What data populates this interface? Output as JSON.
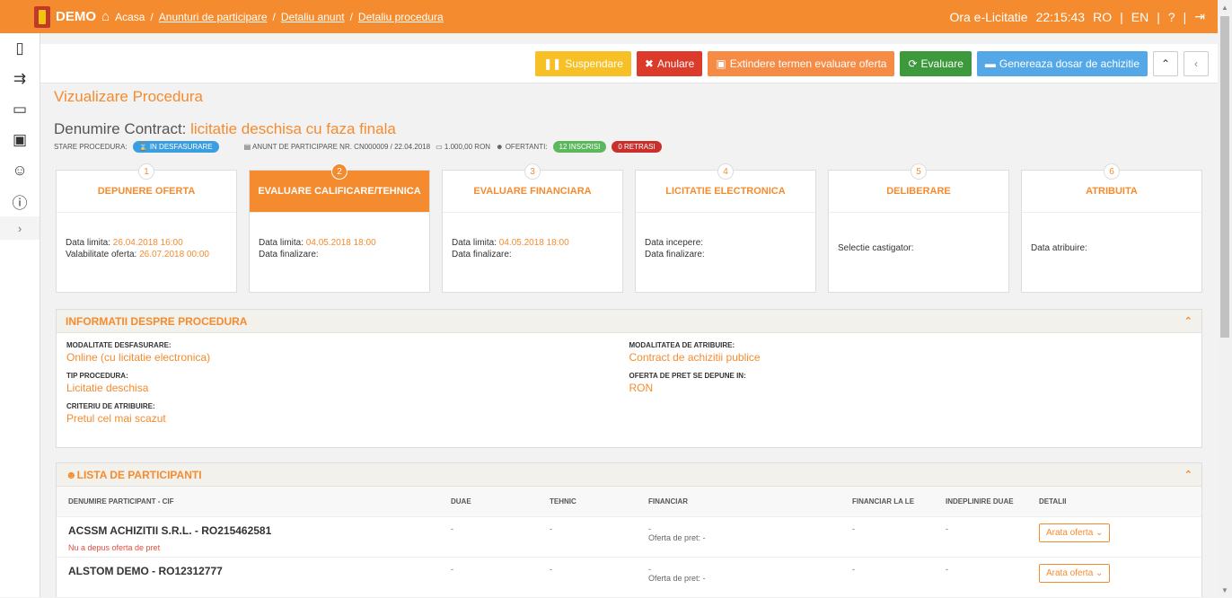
{
  "topbar": {
    "brand": "DEMO",
    "home": "Acasa",
    "breadcrumbs": [
      "Anunturi de participare",
      "Detaliu anunt",
      "Detaliu procedura"
    ],
    "clock_label": "Ora e-Licitatie",
    "clock": "22:15:43",
    "lang_ro": "RO",
    "lang_en": "EN"
  },
  "actions": {
    "suspend": "Suspendare",
    "cancel": "Anulare",
    "extend": "Extindere termen evaluare oferta",
    "evaluate": "Evaluare",
    "generate": "Genereaza dosar de achizitie"
  },
  "page": {
    "title": "Vizualizare Procedura",
    "contract_label": "Denumire Contract:",
    "contract_name": "licitatie deschisa cu faza finala",
    "status_label": "STARE PROCEDURA:",
    "status": "IN DESFASURARE",
    "announce": "ANUNT DE PARTICIPARE NR. CN000009 / 22.04.2018",
    "amount": "1.000,00 RON",
    "bidders_label": "OFERTANTI:",
    "registered": "12 INSCRISI",
    "withdrawn": "0 RETRASI"
  },
  "steps": [
    {
      "num": "1",
      "title": "DEPUNERE OFERTA",
      "l1": "Data limita:",
      "v1": "26.04.2018 16:00",
      "l2": "Valabilitate oferta:",
      "v2": "26.07.2018 00:00"
    },
    {
      "num": "2",
      "title": "EVALUARE CALIFICARE/TEHNICA",
      "l1": "Data limita:",
      "v1": "04.05.2018 18:00",
      "l2": "Data finalizare:",
      "v2": ""
    },
    {
      "num": "3",
      "title": "EVALUARE FINANCIARA",
      "l1": "Data limita:",
      "v1": "04.05.2018 18:00",
      "l2": "Data finalizare:",
      "v2": ""
    },
    {
      "num": "4",
      "title": "LICITATIE ELECTRONICA",
      "l1": "Data incepere:",
      "v1": "",
      "l2": "Data finalizare:",
      "v2": ""
    },
    {
      "num": "5",
      "title": "DELIBERARE",
      "l1": "Selectie castigator:",
      "v1": "",
      "l2": "",
      "v2": ""
    },
    {
      "num": "6",
      "title": "ATRIBUITA",
      "l1": "Data atribuire:",
      "v1": "",
      "l2": "",
      "v2": ""
    }
  ],
  "info": {
    "title": "INFORMATII DESPRE PROCEDURA",
    "mod_label": "MODALITATE DESFASURARE:",
    "mod": "Online (cu licitatie electronica)",
    "tip_label": "TIP PROCEDURA:",
    "tip": "Licitatie deschisa",
    "crit_label": "CRITERIU DE ATRIBUIRE:",
    "crit": "Pretul cel mai scazut",
    "atr_label": "MODALITATEA DE ATRIBUIRE:",
    "atr": "Contract de achizitii publice",
    "pret_label": "OFERTA DE PRET SE DEPUNE IN:",
    "pret": "RON"
  },
  "participants": {
    "title": "LISTA DE PARTICIPANTI",
    "cols": [
      "DENUMIRE PARTICIPANT - CIF",
      "DUAE",
      "TEHNIC",
      "FINANCIAR",
      "FINANCIAR LA LE",
      "INDEPLINIRE DUAE",
      "DETALII"
    ],
    "rows": [
      {
        "name": "ACSSM ACHIZITII S.R.L. - RO215462581",
        "note": "Nu a depus oferta de pret",
        "duae": "-",
        "tehnic": "-",
        "fin": "-",
        "fin_offer": "Oferta de pret: -",
        "fin_le": "-",
        "ind": "-",
        "btn": "Arata oferta"
      },
      {
        "name": "ALSTOM DEMO - RO12312777",
        "note": "",
        "duae": "-",
        "tehnic": "-",
        "fin": "-",
        "fin_offer": "Oferta de pret: -",
        "fin_le": "-",
        "ind": "-",
        "btn": "Arata oferta"
      }
    ]
  }
}
